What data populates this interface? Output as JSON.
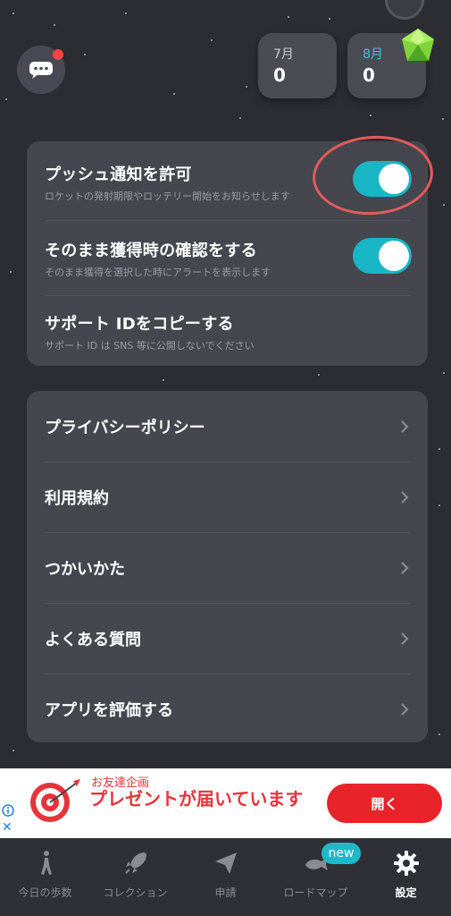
{
  "colors": {
    "background": "#2c2d33",
    "panel": "#45464e",
    "toggle_on": "#18b6c5",
    "accent_month": "#35c9d8",
    "ad_red": "#e8232a",
    "highlight_ring": "#e35b5c"
  },
  "header": {
    "chat_icon": "chat-bubble-icon",
    "months": [
      {
        "label": "7月",
        "value": "0"
      },
      {
        "label": "8月",
        "value": "0"
      }
    ],
    "gem_icon": "green-gem-icon"
  },
  "settings": [
    {
      "title": "プッシュ通知を許可",
      "desc": "ロケットの発射期限やロッテリー開始をお知らせします",
      "toggle": true
    },
    {
      "title": "そのまま獲得時の確認をする",
      "desc": "そのまま獲得を選択した時にアラートを表示します",
      "toggle": true
    },
    {
      "title": "サポート IDをコピーする",
      "desc": "サポート ID は SNS 等に公開しないでください"
    }
  ],
  "links": [
    {
      "label": "プライバシーポリシー"
    },
    {
      "label": "利用規約"
    },
    {
      "label": "つかいかた"
    },
    {
      "label": "よくある質問"
    },
    {
      "label": "アプリを評価する"
    }
  ],
  "ad": {
    "subtitle": "お友達企画",
    "headline": "プレゼントが届いています",
    "button": "開く",
    "close": "✕"
  },
  "tabbar": {
    "items": [
      {
        "label": "今日の歩数",
        "icon": "walking-person-icon"
      },
      {
        "label": "コレクション",
        "icon": "rocket-icon"
      },
      {
        "label": "申請",
        "icon": "paper-plane-icon"
      },
      {
        "label": "ロードマップ",
        "icon": "whale-icon"
      },
      {
        "label": "設定",
        "icon": "gear-icon"
      }
    ],
    "new_badge": "new"
  }
}
